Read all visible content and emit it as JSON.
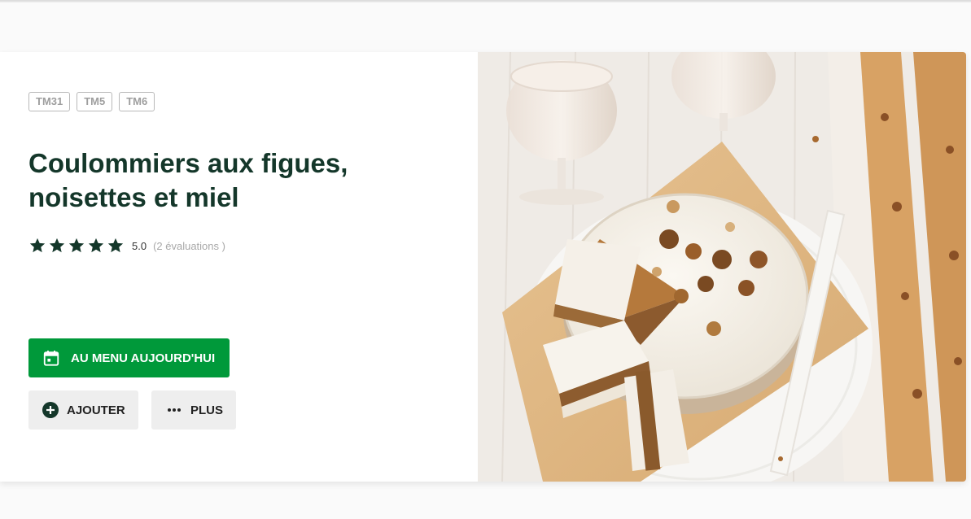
{
  "recipe": {
    "tags": [
      "TM31",
      "TM5",
      "TM6"
    ],
    "title": "Coulommiers aux figues, noisettes et miel",
    "rating": {
      "stars": 5,
      "score": "5.0",
      "count": "(2 évaluations )"
    },
    "actions": {
      "menu_today": {
        "label": "AU MENU AUJOURD'HUI",
        "icon": "calendar-icon"
      },
      "add": {
        "label": "AJOUTER",
        "icon": "plus-circle-icon"
      },
      "more": {
        "label": "PLUS",
        "icon": "more-dots-icon"
      }
    },
    "colors": {
      "title": "#14372a",
      "stars": "#14372a",
      "primary_button": "#00993a"
    }
  }
}
